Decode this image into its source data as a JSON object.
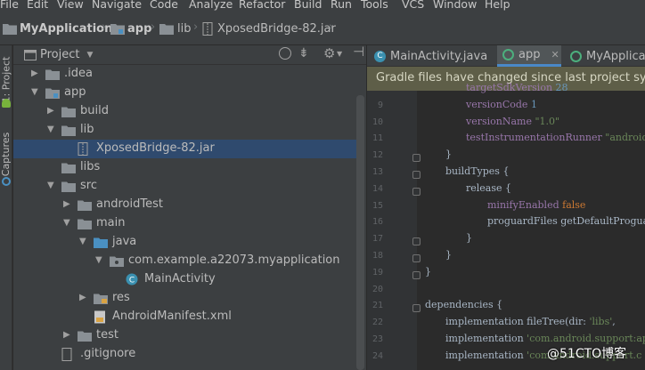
{
  "menu": [
    "File",
    "Edit",
    "View",
    "Navigate",
    "Code",
    "Analyze",
    "Refactor",
    "Build",
    "Run",
    "Tools",
    "VCS",
    "Window",
    "Help"
  ],
  "breadcrumb": [
    "MyApplication",
    "app",
    "lib",
    "XposedBridge-82.jar"
  ],
  "left_strip": {
    "project_tab": "1: Project",
    "captures_tab": "Captures"
  },
  "project_panel": {
    "title": "Project",
    "dropdown_icon": "caret-down-icon"
  },
  "tree": [
    {
      "label": ".idea",
      "depth": 1,
      "expanded": false,
      "icon": "folder-icon"
    },
    {
      "label": "app",
      "depth": 1,
      "expanded": true,
      "icon": "module-folder-icon"
    },
    {
      "label": "build",
      "depth": 2,
      "expanded": false,
      "icon": "folder-icon"
    },
    {
      "label": "lib",
      "depth": 2,
      "expanded": true,
      "icon": "folder-icon"
    },
    {
      "label": "XposedBridge-82.jar",
      "depth": 3,
      "leaf": true,
      "icon": "jar-icon",
      "selected": true
    },
    {
      "label": "libs",
      "depth": 2,
      "leaf": true,
      "icon": "folder-icon"
    },
    {
      "label": "src",
      "depth": 2,
      "expanded": true,
      "icon": "folder-icon"
    },
    {
      "label": "androidTest",
      "depth": 3,
      "expanded": false,
      "icon": "folder-icon"
    },
    {
      "label": "main",
      "depth": 3,
      "expanded": true,
      "icon": "folder-icon"
    },
    {
      "label": "java",
      "depth": 4,
      "expanded": true,
      "icon": "source-folder-icon"
    },
    {
      "label": "com.example.a22073.myapplication",
      "depth": 5,
      "expanded": true,
      "icon": "package-icon"
    },
    {
      "label": "MainActivity",
      "depth": 6,
      "leaf": true,
      "icon": "class-icon"
    },
    {
      "label": "res",
      "depth": 4,
      "expanded": false,
      "icon": "res-folder-icon"
    },
    {
      "label": "AndroidManifest.xml",
      "depth": 4,
      "leaf": true,
      "icon": "xml-icon"
    },
    {
      "label": "test",
      "depth": 3,
      "expanded": false,
      "icon": "folder-icon"
    },
    {
      "label": ".gitignore",
      "depth": 2,
      "leaf": true,
      "icon": "file-icon"
    }
  ],
  "tabs": [
    {
      "label": "MainActivity.java",
      "icon": "class-icon",
      "active": false
    },
    {
      "label": "app",
      "icon": "gradle-icon",
      "active": true
    },
    {
      "label": "MyApplicati",
      "icon": "gradle-icon",
      "active": false
    }
  ],
  "banner": "Gradle files have changed since last project sync. A",
  "code_lines": [
    {
      "n": "",
      "text": "targetSdkVersion 28"
    },
    {
      "n": "9",
      "text": "versionCode 1"
    },
    {
      "n": "10",
      "text": "versionName \"1.0\""
    },
    {
      "n": "11",
      "text": "testInstrumentationRunner \"android"
    },
    {
      "n": "12",
      "text": "}"
    },
    {
      "n": "13",
      "text": "buildTypes {"
    },
    {
      "n": "14",
      "text": "release {"
    },
    {
      "n": "15",
      "text": "minifyEnabled false"
    },
    {
      "n": "16",
      "text": "proguardFiles getDefaultProgua"
    },
    {
      "n": "17",
      "text": "}"
    },
    {
      "n": "18",
      "text": "}"
    },
    {
      "n": "19",
      "text": "}"
    },
    {
      "n": "20",
      "text": ""
    },
    {
      "n": "21",
      "text": "dependencies {"
    },
    {
      "n": "22",
      "text": "implementation fileTree(dir: 'libs',"
    },
    {
      "n": "23",
      "text": "implementation 'com.android.support:ap"
    },
    {
      "n": "24",
      "text": "implementation 'com.android.support.c"
    }
  ],
  "watermark": "@51CTO博客"
}
